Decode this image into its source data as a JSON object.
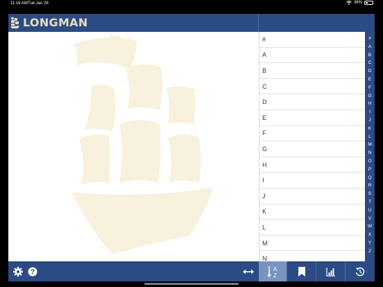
{
  "status_bar": {
    "time": "11:16 AM",
    "date": "Tue Jan 28",
    "battery": "36%",
    "battery_level": 0.36
  },
  "header": {
    "logo_text": "LONGMAN"
  },
  "index_list": {
    "items": [
      "#",
      "A",
      "B",
      "C",
      "D",
      "E",
      "F",
      "G",
      "H",
      "I",
      "J",
      "K",
      "L",
      "M",
      "N"
    ]
  },
  "alphabet_bar": {
    "letters": [
      "#",
      "A",
      "B",
      "C",
      "D",
      "E",
      "F",
      "G",
      "H",
      "I",
      "J",
      "K",
      "L",
      "M",
      "N",
      "O",
      "P",
      "Q",
      "R",
      "S",
      "T",
      "U",
      "V",
      "W",
      "X",
      "Y",
      "Z"
    ]
  },
  "toolbar": {
    "sort_icon_top": "A",
    "sort_icon_bottom": "Z"
  },
  "colors": {
    "header_bg": "#2b4b85",
    "toolbar_active": "#7b93bf",
    "watermark": "#f7f1de",
    "logo": "#e8dcc0"
  }
}
